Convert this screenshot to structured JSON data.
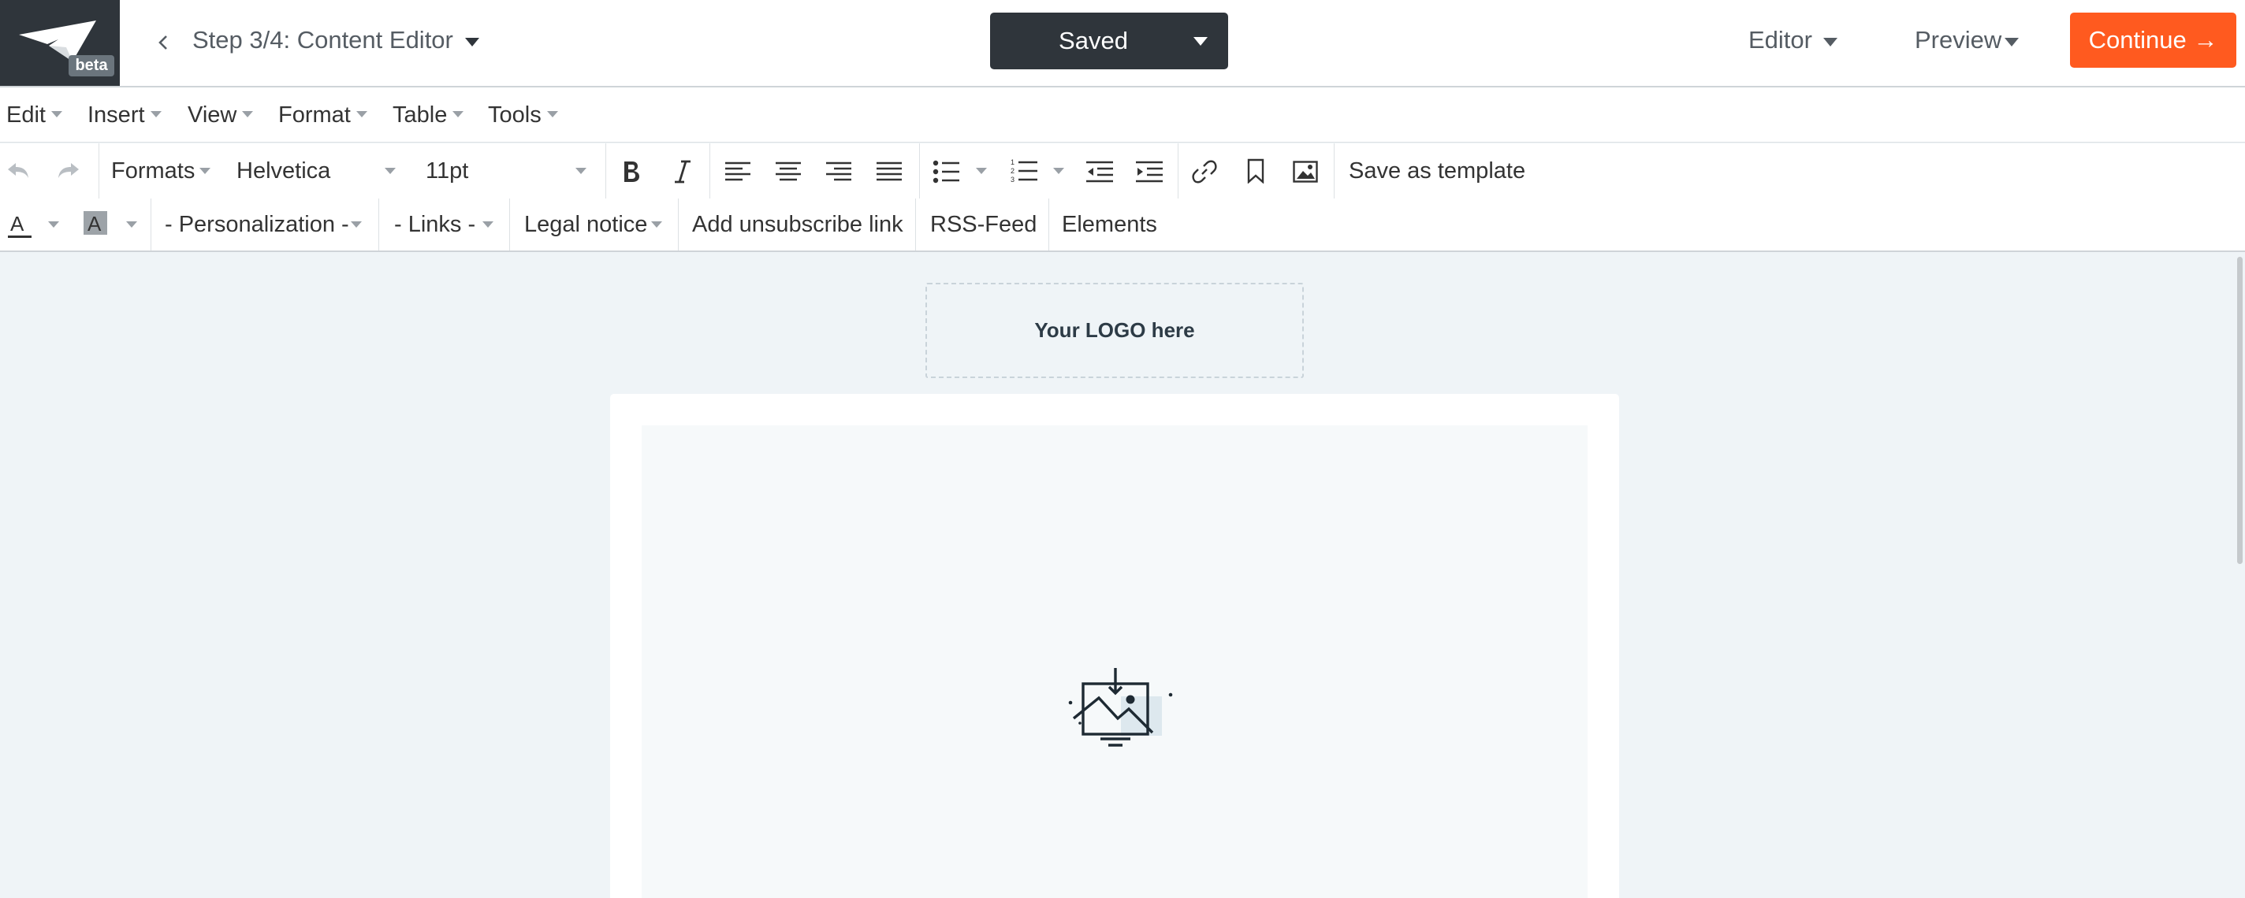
{
  "header": {
    "beta_badge": "beta",
    "step_label": "Step 3/4: Content Editor",
    "saved_label": "Saved",
    "editor_label": "Editor",
    "preview_label": "Preview",
    "continue_label": "Continue →"
  },
  "menubar": {
    "items": [
      "Edit",
      "Insert",
      "View",
      "Format",
      "Table",
      "Tools"
    ]
  },
  "toolbar": {
    "formats_label": "Formats",
    "font_family": "Helvetica",
    "font_size": "11pt",
    "save_template_label": "Save as template",
    "personalization_label": "- Personalization -",
    "links_label": "- Links -",
    "legal_notice_label": "Legal notice",
    "unsubscribe_label": "Add unsubscribe link",
    "rss_label": "RSS-Feed",
    "elements_label": "Elements"
  },
  "content": {
    "logo_placeholder": "Your LOGO here"
  },
  "colors": {
    "accent": "#ff5a1f",
    "dark": "#2f353b",
    "canvas": "#eff4f7"
  }
}
